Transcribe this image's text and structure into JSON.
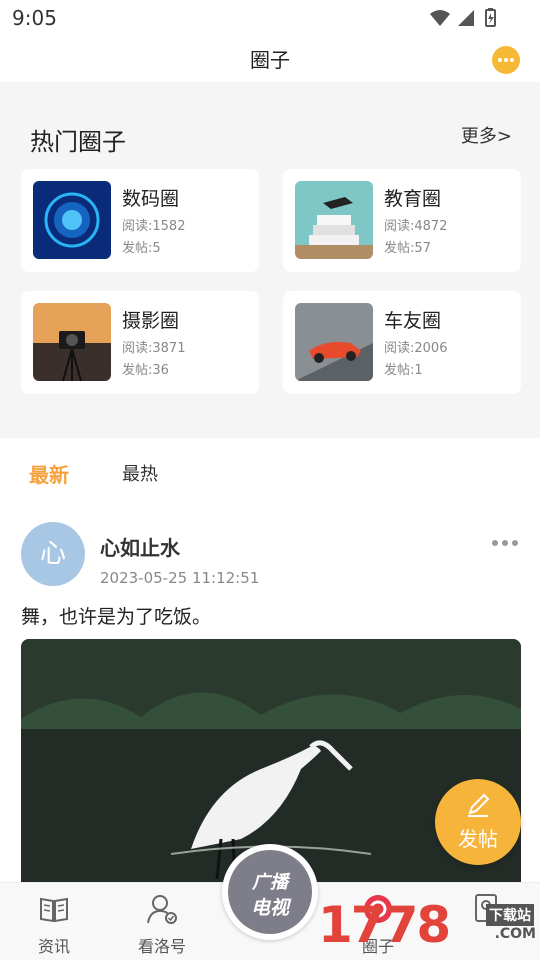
{
  "status_bar": {
    "time": "9:05"
  },
  "title_bar": {
    "title": "圈子"
  },
  "hot_circles": {
    "heading": "热门圈子",
    "more": "更多>",
    "items": [
      {
        "name": "数码圈",
        "reads": "阅读:1582",
        "posts": "发帖:5"
      },
      {
        "name": "教育圈",
        "reads": "阅读:4872",
        "posts": "发帖:57"
      },
      {
        "name": "摄影圈",
        "reads": "阅读:3871",
        "posts": "发帖:36"
      },
      {
        "name": "车友圈",
        "reads": "阅读:2006",
        "posts": "发帖:1"
      }
    ]
  },
  "tabs": {
    "latest": "最新",
    "hot": "最热"
  },
  "post": {
    "avatar_char": "心",
    "author": "心如止水",
    "time": "2023-05-25 11:12:51",
    "text": "舞，也许是为了吃饭。"
  },
  "fab": {
    "label": "发帖"
  },
  "tv_button": {
    "line1": "广播",
    "line2": "电视"
  },
  "bottom_nav": {
    "items": [
      {
        "label": "资讯"
      },
      {
        "label": "看洛号"
      },
      {
        "label": "圈子"
      },
      {
        "label": ""
      }
    ]
  },
  "watermark": {
    "number": "1778",
    "cn": "下载站",
    "com": ".COM"
  },
  "colors": {
    "accent": "#f6a23c",
    "fab": "#f7b43b",
    "avatar": "#a8c7e4",
    "tv": "#7d7e8a",
    "section_bg": "#f5f5f5"
  }
}
